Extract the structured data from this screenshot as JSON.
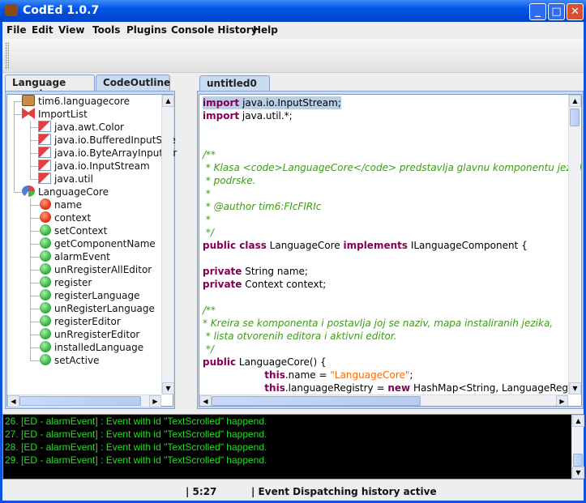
{
  "window": {
    "title": "CodEd 1.0.7",
    "minimize": "_",
    "maximize": "□",
    "close": "✕"
  },
  "menu": [
    "File",
    "Edit",
    "View",
    "Tools",
    "Plugins",
    "Console History",
    "Help"
  ],
  "left_tabs": [
    "Language panel",
    "CodeOutline"
  ],
  "active_left_tab": "CodeOutline",
  "tree": {
    "package": "tim6.languagecore",
    "import_list": "ImportList",
    "imports": [
      "java.awt.Color",
      "java.io.BufferedInputStre",
      "java.io.ByteArrayInputStr",
      "java.io.InputStream",
      "java.util"
    ],
    "class": "LanguageCore",
    "members": [
      {
        "name": "name",
        "kind": "field"
      },
      {
        "name": "context",
        "kind": "field"
      },
      {
        "name": "setContext",
        "kind": "method"
      },
      {
        "name": "getComponentName",
        "kind": "method"
      },
      {
        "name": "alarmEvent",
        "kind": "method"
      },
      {
        "name": "unRregisterAllEditor",
        "kind": "method"
      },
      {
        "name": "register",
        "kind": "method"
      },
      {
        "name": "registerLanguage",
        "kind": "method"
      },
      {
        "name": "unRegisterLanguage",
        "kind": "method"
      },
      {
        "name": "registerEditor",
        "kind": "method"
      },
      {
        "name": "unRregisterEditor",
        "kind": "method"
      },
      {
        "name": "installedLanguage",
        "kind": "method"
      },
      {
        "name": "setActive",
        "kind": "method"
      }
    ]
  },
  "editor": {
    "tab": "untitled0",
    "tab_close": "✕",
    "lines": [
      [
        [
          "kw",
          "import"
        ],
        [
          "",
          "java.io.InputStream;"
        ]
      ],
      [
        [
          "kw",
          "import"
        ],
        [
          "",
          " java.util.*;"
        ]
      ],
      [],
      [],
      [
        [
          "cm",
          "/**"
        ]
      ],
      [
        [
          "cm",
          " * Klasa <code>LanguageCore</code> predstavlja glavnu komponentu jezicke"
        ]
      ],
      [
        [
          "cm",
          " * podrske."
        ]
      ],
      [
        [
          "cm",
          " *"
        ]
      ],
      [
        [
          "cm",
          " * @author tim6:FIcFIRIc"
        ]
      ],
      [
        [
          "cm",
          " *"
        ]
      ],
      [
        [
          "cm",
          " */"
        ]
      ],
      [
        [
          "kw",
          "public class"
        ],
        [
          "",
          " LanguageCore "
        ],
        [
          "kw",
          "implements"
        ],
        [
          "",
          " ILanguageComponent {"
        ]
      ],
      [],
      [
        [
          "kw",
          "private"
        ],
        [
          "",
          " String name;"
        ]
      ],
      [
        [
          "kw",
          "private"
        ],
        [
          "",
          " Context context;"
        ]
      ],
      [],
      [
        [
          "cm",
          "/**"
        ]
      ],
      [
        [
          "cm",
          "* Kreira se komponenta i postavlja joj se naziv, mapa instaliranih jezika,"
        ]
      ],
      [
        [
          "cm",
          " * lista otvorenih editora i aktivni editor."
        ]
      ],
      [
        [
          "cm",
          " */"
        ]
      ],
      [
        [
          "kw",
          "public"
        ],
        [
          "",
          " LanguageCore() {"
        ]
      ],
      [
        [
          "",
          "                    "
        ],
        [
          "kw",
          "this"
        ],
        [
          "",
          ".name = "
        ],
        [
          "st",
          "\"LanguageCore\""
        ],
        [
          "",
          ";"
        ]
      ],
      [
        [
          "",
          "                    "
        ],
        [
          "kw",
          "this"
        ],
        [
          "",
          ".languageRegistry = "
        ],
        [
          "kw",
          "new"
        ],
        [
          "",
          " HashMap<String, LanguageRegistryElem"
        ]
      ]
    ]
  },
  "console": [
    "26. [ED - alarmEvent] : Event with id \"TextScrolled\" happend.",
    "27. [ED - alarmEvent] : Event with id \"TextScrolled\" happend.",
    "28. [ED - alarmEvent] : Event with id \"TextScrolled\" happend.",
    "29. [ED - alarmEvent] : Event with id \"TextScrolled\" happend."
  ],
  "status": {
    "position": "| 5:27",
    "message": "| Event Dispatching history active"
  },
  "colors": {
    "keyword": "#7f0055",
    "comment": "#3f9a1a",
    "string": "#ff6600",
    "console_text": "#20e020",
    "console_bg": "#000000"
  }
}
